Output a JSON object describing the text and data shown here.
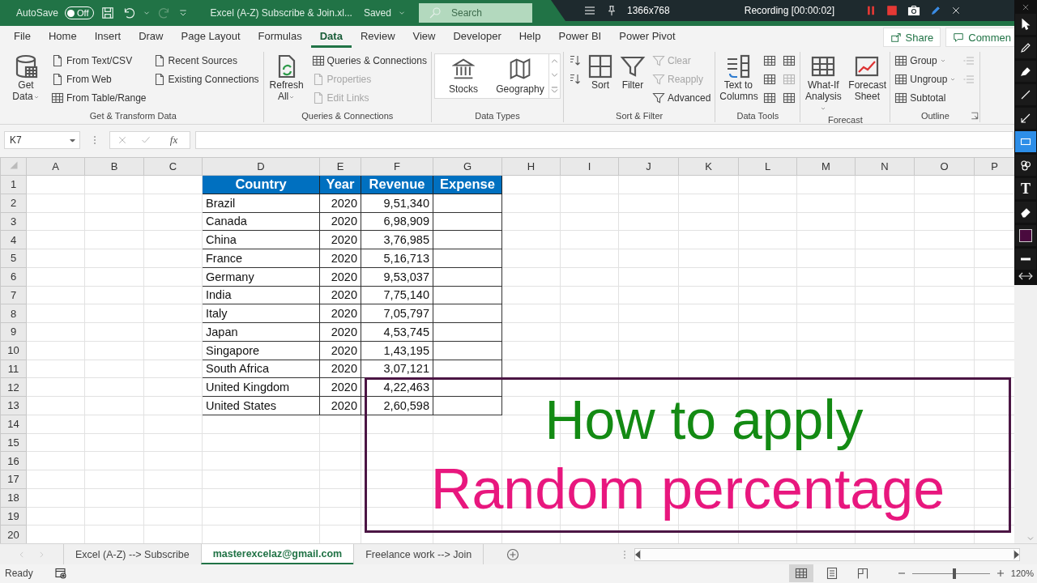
{
  "title_bar": {
    "autosave_label": "AutoSave",
    "autosave_toggle": {
      "label": "Off",
      "on": false
    },
    "document_title": "Excel (A-Z) Subscribe & Join.xl...",
    "save_status": "Saved",
    "search": {
      "placeholder": "Search"
    }
  },
  "recorder_bar": {
    "resolution": "1366x768",
    "status": "Recording [00:00:02]"
  },
  "menu_tabs": [
    {
      "label": "File",
      "selected": false
    },
    {
      "label": "Home",
      "selected": false
    },
    {
      "label": "Insert",
      "selected": false
    },
    {
      "label": "Draw",
      "selected": false
    },
    {
      "label": "Page Layout",
      "selected": false
    },
    {
      "label": "Formulas",
      "selected": false
    },
    {
      "label": "Data",
      "selected": true
    },
    {
      "label": "Review",
      "selected": false
    },
    {
      "label": "View",
      "selected": false
    },
    {
      "label": "Developer",
      "selected": false
    },
    {
      "label": "Help",
      "selected": false
    },
    {
      "label": "Power BI",
      "selected": false
    },
    {
      "label": "Power Pivot",
      "selected": false
    }
  ],
  "share_button": "Share",
  "comments_button": "Commen",
  "ribbon_groups": [
    {
      "title": "Get & Transform Data",
      "items": [
        {
          "kind": "large",
          "label": "Get Data",
          "dropdown": true,
          "disabled": false
        },
        {
          "kind": "small",
          "label": "From Text/CSV",
          "disabled": false
        },
        {
          "kind": "small",
          "label": "From Web",
          "disabled": false
        },
        {
          "kind": "small",
          "label": "From Table/Range",
          "disabled": false
        },
        {
          "kind": "small",
          "label": "Recent Sources",
          "disabled": false
        },
        {
          "kind": "small",
          "label": "Existing Connections",
          "disabled": false
        }
      ]
    },
    {
      "title": "Queries & Connections",
      "items": [
        {
          "kind": "large",
          "label": "Refresh All",
          "dropdown": true,
          "disabled": false
        },
        {
          "kind": "small",
          "label": "Queries & Connections",
          "disabled": false
        },
        {
          "kind": "small",
          "label": "Properties",
          "disabled": true
        },
        {
          "kind": "small",
          "label": "Edit Links",
          "disabled": true
        }
      ]
    },
    {
      "title": "Data Types",
      "items": [
        {
          "kind": "gallery",
          "label": "Stocks",
          "disabled": false
        },
        {
          "kind": "gallery",
          "label": "Geography",
          "disabled": false
        }
      ]
    },
    {
      "title": "Sort & Filter",
      "items": [
        {
          "kind": "icon",
          "disabled": false
        },
        {
          "kind": "icon",
          "disabled": false
        },
        {
          "kind": "large",
          "label": "Sort",
          "dropdown": false,
          "disabled": false
        },
        {
          "kind": "large",
          "label": "Filter",
          "dropdown": false,
          "disabled": false
        },
        {
          "kind": "small",
          "label": "Clear",
          "disabled": true
        },
        {
          "kind": "small",
          "label": "Reapply",
          "disabled": true
        },
        {
          "kind": "small",
          "label": "Advanced",
          "disabled": false
        }
      ]
    },
    {
      "title": "Data Tools",
      "items": [
        {
          "kind": "large",
          "label": "Text to Columns",
          "dropdown": false,
          "disabled": false
        },
        {
          "kind": "icon",
          "disabled": false
        },
        {
          "kind": "icon",
          "disabled": false
        },
        {
          "kind": "icon",
          "disabled": false
        },
        {
          "kind": "icon",
          "disabled": false
        },
        {
          "kind": "icon",
          "disabled": true
        },
        {
          "kind": "icon",
          "disabled": false
        }
      ]
    },
    {
      "title": "Forecast",
      "items": [
        {
          "kind": "large",
          "label": "What-If Analysis",
          "dropdown": true,
          "disabled": false
        },
        {
          "kind": "large",
          "label": "Forecast Sheet",
          "dropdown": false,
          "disabled": false
        }
      ]
    },
    {
      "title": "Outline",
      "items": [
        {
          "kind": "small",
          "label": "Group",
          "dropdown": true,
          "disabled": false
        },
        {
          "kind": "small",
          "label": "Ungroup",
          "dropdown": true,
          "disabled": false
        },
        {
          "kind": "small",
          "label": "Subtotal",
          "disabled": false
        },
        {
          "kind": "icon",
          "disabled": true
        },
        {
          "kind": "icon",
          "disabled": true
        }
      ]
    }
  ],
  "formula_bar": {
    "name_box": "K7",
    "function_label": "fx"
  },
  "columns": [
    "A",
    "B",
    "C",
    "D",
    "E",
    "F",
    "G",
    "H",
    "I",
    "J",
    "K",
    "L",
    "M",
    "N",
    "O",
    "P"
  ],
  "row_numbers": [
    "1",
    "2",
    "3",
    "4",
    "5",
    "6",
    "7",
    "8",
    "9",
    "10",
    "11",
    "12",
    "13",
    "14",
    "15",
    "16",
    "17",
    "18",
    "19",
    "20"
  ],
  "table": {
    "headers": [
      "Country",
      "Year",
      "Revenue",
      "Expense"
    ],
    "rows": [
      {
        "country": "Brazil",
        "year": "2020",
        "revenue": "9,51,340"
      },
      {
        "country": "Canada",
        "year": "2020",
        "revenue": "6,98,909"
      },
      {
        "country": "China",
        "year": "2020",
        "revenue": "3,76,985"
      },
      {
        "country": "France",
        "year": "2020",
        "revenue": "5,16,713"
      },
      {
        "country": "Germany",
        "year": "2020",
        "revenue": "9,53,037"
      },
      {
        "country": "India",
        "year": "2020",
        "revenue": "7,75,140"
      },
      {
        "country": "Italy",
        "year": "2020",
        "revenue": "7,05,797"
      },
      {
        "country": "Japan",
        "year": "2020",
        "revenue": "4,53,745"
      },
      {
        "country": "Singapore",
        "year": "2020",
        "revenue": "1,43,195"
      },
      {
        "country": "South Africa",
        "year": "2020",
        "revenue": "3,07,121"
      },
      {
        "country": "United Kingdom",
        "year": "2020",
        "revenue": "4,22,463"
      },
      {
        "country": "United States",
        "year": "2020",
        "revenue": "2,60,598"
      }
    ]
  },
  "caption_box": {
    "line_1": "How to apply",
    "line_2": "Random percentage"
  },
  "sheet_tabs": [
    {
      "label": "Excel (A-Z) --> Subscribe",
      "selected": false
    },
    {
      "label": "masterexcelaz@gmail.com",
      "selected": true
    },
    {
      "label": "Freelance work --> Join",
      "selected": false
    }
  ],
  "status_bar": {
    "status": "Ready",
    "zoom": "120%",
    "zoom_slider": {
      "level": 0.54
    }
  },
  "annotation_tools": [
    {
      "kind": "cursor",
      "selected": false
    },
    {
      "kind": "pencil",
      "selected": false
    },
    {
      "kind": "marker",
      "selected": false
    },
    {
      "kind": "line",
      "selected": false
    },
    {
      "kind": "arrow",
      "selected": false
    },
    {
      "kind": "rectangle",
      "selected": true
    },
    {
      "kind": "stamp",
      "selected": false
    },
    {
      "kind": "text",
      "label": "T",
      "selected": false
    },
    {
      "kind": "eraser",
      "selected": false
    },
    {
      "kind": "color",
      "selected": false
    },
    {
      "kind": "width",
      "selected": false
    }
  ]
}
